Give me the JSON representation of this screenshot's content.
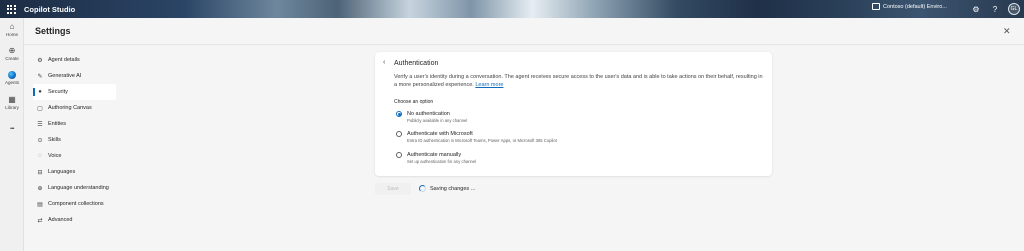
{
  "app": {
    "title": "Copilot Studio"
  },
  "header": {
    "environment_label": "Contoso (default) Enviro...",
    "settings_glyph": "⚙",
    "help_glyph": "?",
    "avatar_initials": "GL"
  },
  "rail": {
    "items": [
      {
        "label": "Home",
        "icon": "home-icon",
        "glyph": "⌂"
      },
      {
        "label": "Create",
        "icon": "plus-circle-icon",
        "glyph": "⊕"
      },
      {
        "label": "Agents",
        "icon": "agents-icon",
        "glyph": ""
      },
      {
        "label": "Library",
        "icon": "library-icon",
        "glyph": "▦"
      },
      {
        "label": "",
        "icon": "more-icon",
        "glyph": "•••"
      }
    ]
  },
  "page": {
    "title": "Settings",
    "close_glyph": "✕"
  },
  "nav": {
    "items": [
      {
        "label": "Agent details",
        "icon": "gear-icon",
        "glyph": "⚙"
      },
      {
        "label": "Generative AI",
        "icon": "sparkle-icon",
        "glyph": "✎"
      },
      {
        "label": "Security",
        "icon": "shield-icon",
        "glyph": "●"
      },
      {
        "label": "Authoring Canvas",
        "icon": "canvas-icon",
        "glyph": "▢"
      },
      {
        "label": "Entities",
        "icon": "entities-icon",
        "glyph": "☰"
      },
      {
        "label": "Skills",
        "icon": "skills-icon",
        "glyph": "⊙"
      },
      {
        "label": "Voice",
        "icon": "voice-icon",
        "glyph": "◌"
      },
      {
        "label": "Languages",
        "icon": "languages-icon",
        "glyph": "⊟"
      },
      {
        "label": "Language understanding",
        "icon": "language-understanding-icon",
        "glyph": "⊕"
      },
      {
        "label": "Component collections",
        "icon": "collections-icon",
        "glyph": "▤"
      },
      {
        "label": "Advanced",
        "icon": "advanced-icon",
        "glyph": "⇄"
      }
    ],
    "active_index": 2
  },
  "auth": {
    "back_glyph": "‹",
    "title": "Authentication",
    "description": "Verify a user's identity during a conversation. The agent receives secure access to the user's data and is able to take actions on their behalf, resulting in a more personalized experience.",
    "learn_more": "Learn more",
    "choose_label": "Choose an option",
    "options": [
      {
        "label": "No authentication",
        "sub": "Publicly available in any channel",
        "selected": true
      },
      {
        "label": "Authenticate with Microsoft",
        "sub": "Entra ID authentication in Microsoft Teams, Power Apps, or Microsoft 365 Copilot",
        "selected": false
      },
      {
        "label": "Authenticate manually",
        "sub": "Set up authentication for any channel",
        "selected": false
      }
    ]
  },
  "footer": {
    "save_label": "Save",
    "status_text": "Saving changes ..."
  },
  "colors": {
    "accent": "#0f6cbd",
    "background": "#f5f5f5"
  }
}
